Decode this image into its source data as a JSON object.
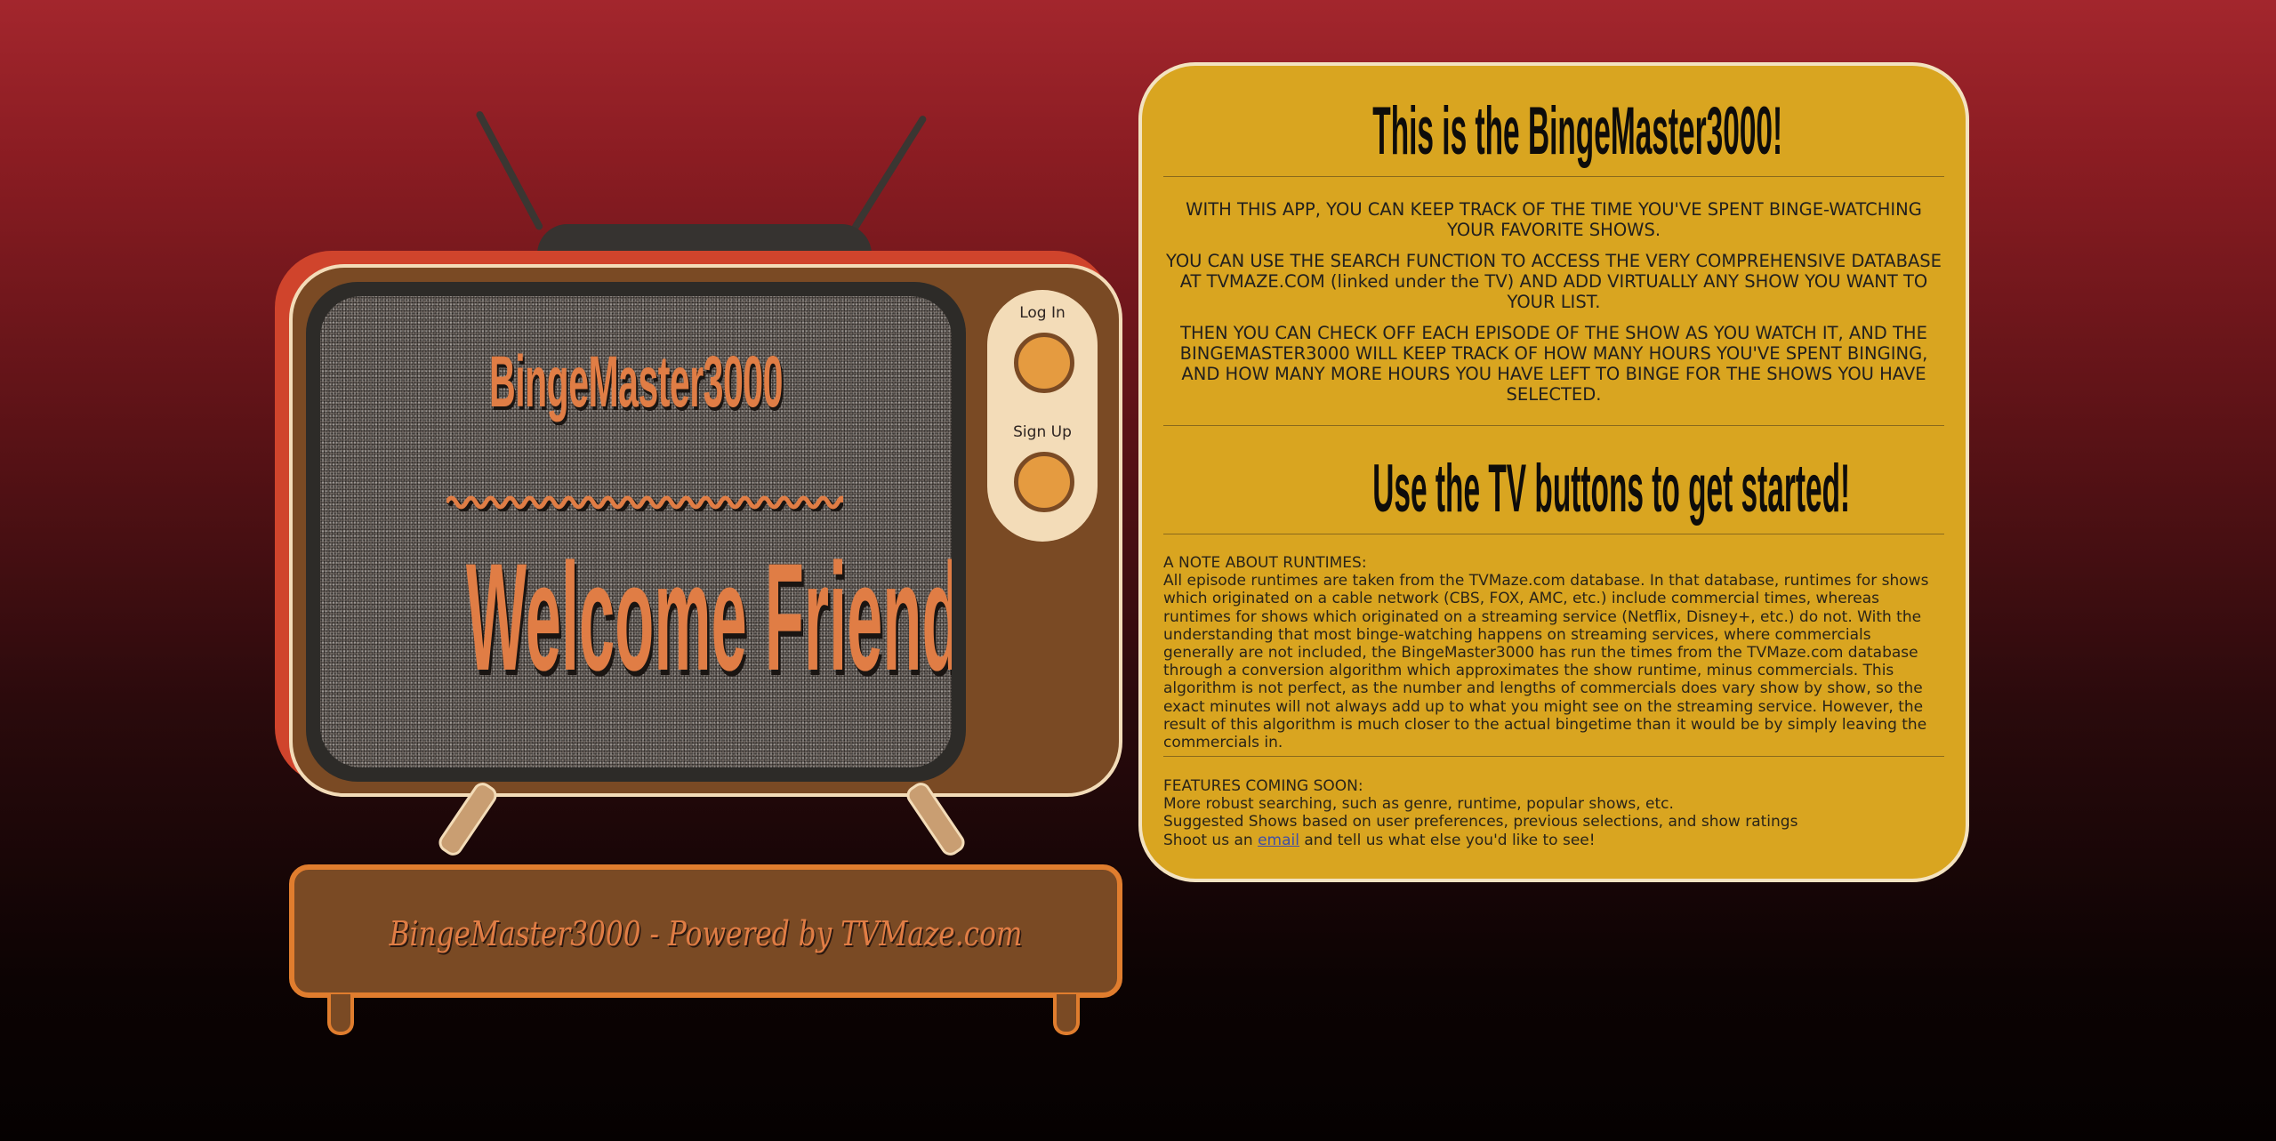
{
  "tv": {
    "screen_title": "BingeMaster3000",
    "screen_welcome": "Welcome Friend!",
    "login_label": "Log In",
    "signup_label": "Sign Up",
    "stand_caption": "BingeMaster3000 - Powered by TVMaze.com"
  },
  "info": {
    "heading": "This is the BingeMaster3000!",
    "para1": "WITH THIS APP, YOU CAN KEEP TRACK OF THE TIME YOU'VE SPENT BINGE-WATCHING YOUR FAVORITE SHOWS.",
    "para2": "YOU CAN USE THE SEARCH FUNCTION TO ACCESS THE VERY COMPREHENSIVE DATABASE AT TVMAZE.COM (linked under the TV) AND ADD VIRTUALLY ANY SHOW YOU WANT TO YOUR LIST.",
    "para3": "THEN YOU CAN CHECK OFF EACH EPISODE OF THE SHOW AS YOU WATCH IT, AND THE BINGEMASTER3000 WILL KEEP TRACK OF HOW MANY HOURS YOU'VE SPENT BINGING, AND HOW MANY MORE HOURS YOU HAVE LEFT TO BINGE FOR THE SHOWS YOU HAVE SELECTED.",
    "cta_heading": "Use the TV buttons to get started!",
    "runtime_note_title": "A NOTE ABOUT RUNTIMES:",
    "runtime_note_body": "All episode runtimes are taken from the TVMaze.com database. In that database, runtimes for shows which originated on a cable network (CBS, FOX, AMC, etc.) include commercial times, whereas runtimes for shows which originated on a streaming service (Netflix, Disney+, etc.) do not. With the understanding that most binge-watching happens on streaming services, where commercials generally are not included, the BingeMaster3000 has run the times from the TVMaze.com database through a conversion algorithm which approximates the show runtime, minus commercials. This algorithm is not perfect, as the number and lengths of commercials does vary show by show, so the exact minutes will not always add up to what you might see on the streaming service. However, the result of this algorithm is much closer to the actual bingetime than it would be by simply leaving the commercials in.",
    "features_title": "FEATURES COMING SOON:",
    "features": [
      "More robust searching, such as genre, runtime, popular shows, etc.",
      "Suggested Shows based on user preferences, previous selections, and show ratings"
    ],
    "contact_prefix": "Shoot us an ",
    "contact_link": "email",
    "contact_suffix": " and tell us what else you'd like to see!"
  },
  "colors": {
    "tv_wood": "#7a4a24",
    "tv_accent": "#e07d45",
    "knob": "#e59b40",
    "card": "#d9a520",
    "frame_red": "#d0442c"
  }
}
